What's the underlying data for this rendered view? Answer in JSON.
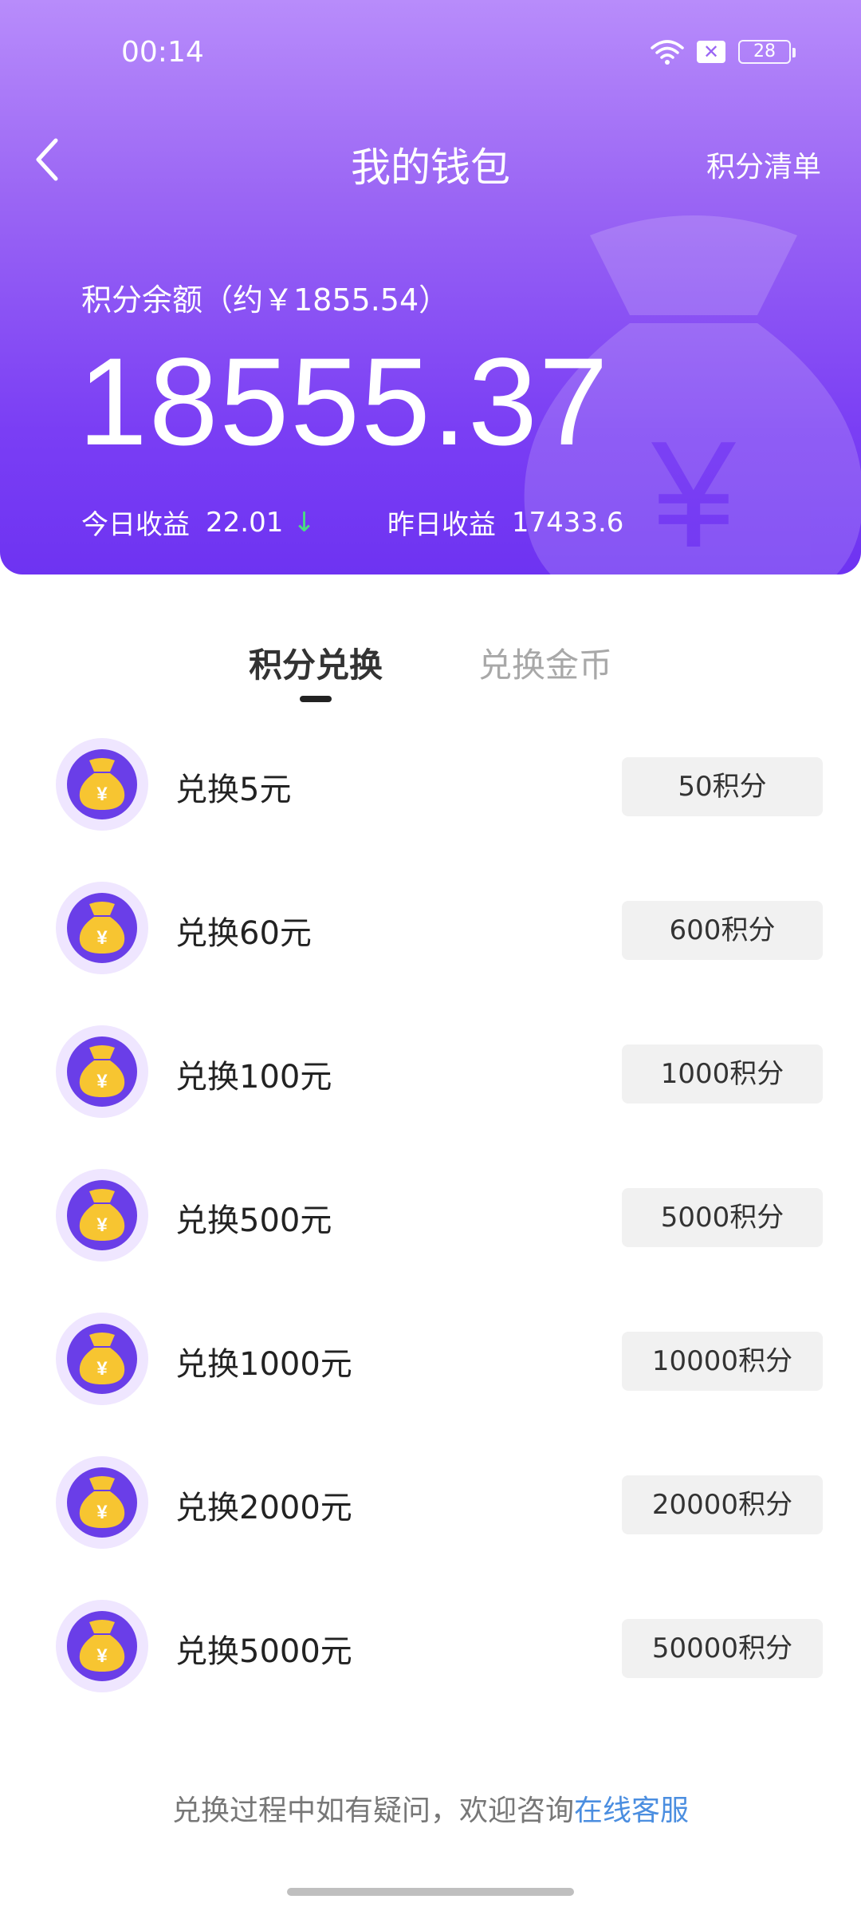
{
  "statusbar": {
    "time": "00:14",
    "battery": "28",
    "notification": "✕"
  },
  "nav": {
    "title": "我的钱包",
    "right_link": "积分清单"
  },
  "balance": {
    "label": "积分余额（约￥1855.54）",
    "value": "18555.37",
    "today_label": "今日收益",
    "today_value": "22.01",
    "yesterday_label": "昨日收益",
    "yesterday_value": "17433.6"
  },
  "tabs": [
    {
      "label": "积分兑换",
      "active": true
    },
    {
      "label": "兑换金币",
      "active": false
    }
  ],
  "exchange_items": [
    {
      "label": "兑换5元",
      "button": "50积分"
    },
    {
      "label": "兑换60元",
      "button": "600积分"
    },
    {
      "label": "兑换100元",
      "button": "1000积分"
    },
    {
      "label": "兑换500元",
      "button": "5000积分"
    },
    {
      "label": "兑换1000元",
      "button": "10000积分"
    },
    {
      "label": "兑换2000元",
      "button": "20000积分"
    },
    {
      "label": "兑换5000元",
      "button": "50000积分"
    }
  ],
  "footer": {
    "text": "兑换过程中如有疑问，欢迎咨询",
    "link": "在线客服"
  },
  "colors": {
    "header_top": "#b88cfb",
    "header_bottom": "#6e33f2",
    "coin_bg": "#efe6ff",
    "coin_inner": "#6a3ee8",
    "coin_gold": "#f7c531",
    "link": "#4b8ee0",
    "up_down_arrow": "#4ade80"
  },
  "icons": {
    "back": "chevron-left-icon",
    "wifi": "wifi-icon",
    "notification": "close-box-icon",
    "battery": "battery-icon",
    "trend": "arrow-down-icon",
    "money_bag": "money-bag-icon"
  }
}
